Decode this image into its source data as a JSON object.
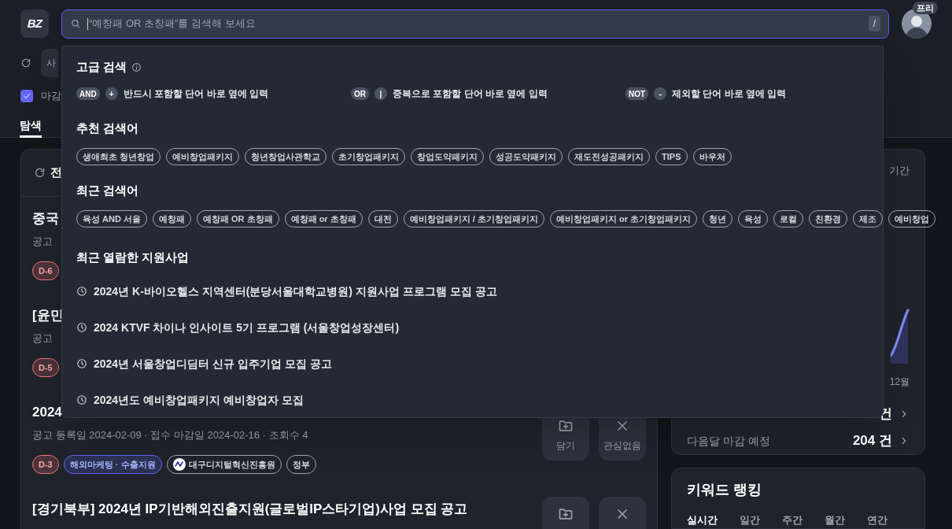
{
  "header": {
    "logo_text": "BZ",
    "search": {
      "placeholder": "“예창패 OR 초창패”를 검색해 보세요",
      "shortcut": "/"
    },
    "profile_badge": "프리"
  },
  "toolbar": {
    "filter_button": "사",
    "checkbox": {
      "label": "마감",
      "checked": true
    }
  },
  "tabs": [
    {
      "label": "탐색",
      "selected": true
    }
  ],
  "search_dropdown": {
    "advanced_title": "고급 검색",
    "operators": [
      {
        "keyword": "AND",
        "symbol": "+",
        "description": "반드시 포함할 단어 바로 옆에 입력"
      },
      {
        "keyword": "OR",
        "symbol": "|",
        "description": "중복으로 포함할 단어 바로 옆에 입력"
      },
      {
        "keyword": "NOT",
        "symbol": "-",
        "description": "제외할 단어 바로 옆에 입력"
      }
    ],
    "recommended_title": "추천 검색어",
    "recommended": [
      "생애최초 청년창업",
      "예비창업패키지",
      "청년창업사관학교",
      "초기창업패키지",
      "창업도약패키지",
      "성공도약패키지",
      "재도전성공패키지",
      "TIPS",
      "바우처"
    ],
    "recent_title": "최근 검색어",
    "recent": [
      "육성 AND 서울",
      "예창패",
      "예창패 OR 초창패",
      "예창패 or 초창패",
      "대전",
      "예비창업패키지 / 초기창업패키지",
      "예비창업패키지 or 초기창업패키지",
      "청년",
      "육성",
      "로컬",
      "친환경",
      "제조",
      "예비창업"
    ],
    "viewed_title": "최근 열람한 지원사업",
    "viewed": [
      "2024년 K-바이오헬스 지역센터(분당서울대학교병원) 지원사업 프로그램 모집 공고",
      "2024 KTVF 차이나 인사이트 5기 프로그램 (서울창업성장센터)",
      "2024년 서울창업디딤터 신규 입주기업 모집 공고",
      "2024년도 예비창업패키지 예비창업자 모집"
    ]
  },
  "list": {
    "title": "전",
    "items": [
      {
        "title": "중국",
        "meta": "공고",
        "tags": [
          {
            "kind": "dday",
            "label": "D-6"
          }
        ]
      },
      {
        "title": "[윤민",
        "meta": "공고",
        "tags": [
          {
            "kind": "dday",
            "label": "D-5"
          }
        ]
      },
      {
        "title": "2024",
        "meta": "공고 등록일 2024-02-09 · 접수 마감일 2024-02-16 · 조회수 4",
        "tags": [
          {
            "kind": "dday",
            "label": "D-3"
          },
          {
            "kind": "category",
            "label": "해외마케팅 · 수출지원"
          },
          {
            "kind": "agency",
            "label": "대구디지털혁신진흥원"
          },
          {
            "kind": "type",
            "label": "정부"
          }
        ],
        "actions": [
          {
            "kind": "save",
            "label": "담기"
          },
          {
            "kind": "dismiss",
            "label": "관심없음"
          }
        ]
      },
      {
        "title": "[경기북부] 2024년 IP기반해외진출지원(글로벌IP스타기업)사업 모집 공고",
        "actions": [
          {
            "kind": "save"
          },
          {
            "kind": "dismiss"
          }
        ]
      }
    ]
  },
  "stats": {
    "period_label": "기간",
    "chart_month": "12월",
    "rows": [
      {
        "value": "건"
      },
      {
        "label": "다음달 마감 예정",
        "value": "204 건"
      }
    ]
  },
  "ranking": {
    "title": "키워드 랭킹",
    "tabs": [
      {
        "label": "실시간",
        "selected": true
      },
      {
        "label": "일간",
        "selected": false
      },
      {
        "label": "주간",
        "selected": false
      },
      {
        "label": "월간",
        "selected": false
      },
      {
        "label": "연간",
        "selected": false
      }
    ]
  }
}
